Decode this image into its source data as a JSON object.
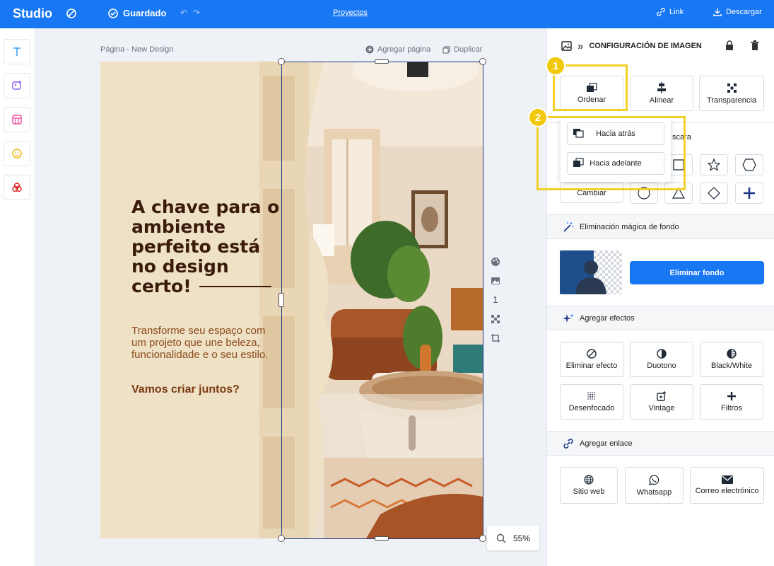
{
  "topbar": {
    "logo": "Studio",
    "saved": "Guardado",
    "projects": "Proyectos",
    "link": "Link",
    "download": "Descargar"
  },
  "canvas": {
    "page_label": "Página - New Design",
    "add_page": "Agregar página",
    "duplicate": "Duplicar",
    "page_number": "1",
    "zoom": "55%"
  },
  "design": {
    "headline": "A chave para o ambiente perfeito está no design certo!",
    "body": "Transforme seu espaço com um projeto que une beleza, funcionalidade e o seu estilo.",
    "cta": "Vamos criar juntos?"
  },
  "panel": {
    "title": "CONFIGURACIÓN DE IMAGEN",
    "order_label": "Ordenar",
    "align_label": "Alinear",
    "transparency_label": "Transparencia",
    "mask_label_partial": "scara",
    "change_label": "Cambiar",
    "magic_remove_label": "Eliminación mágica de fondo",
    "remove_bg_button": "Eliminar fondo",
    "effects_label": "Agregar efectos",
    "effects": [
      "Eliminar efecto",
      "Duotono",
      "Black/White",
      "Desenfocado",
      "Vintage",
      "Filtros"
    ],
    "link_label": "Agregar enlace",
    "links": [
      "Sitio web",
      "Whatsapp",
      "Correo electrónico"
    ]
  },
  "dropdown": {
    "back": "Hacia atrás",
    "forward": "Hacia adelante"
  },
  "callouts": {
    "one": "1",
    "two": "2"
  },
  "colors": {
    "brand": "#1877f2",
    "callout": "#f2d028",
    "headline": "#3a1a0a",
    "body": "#8b4a1c"
  }
}
